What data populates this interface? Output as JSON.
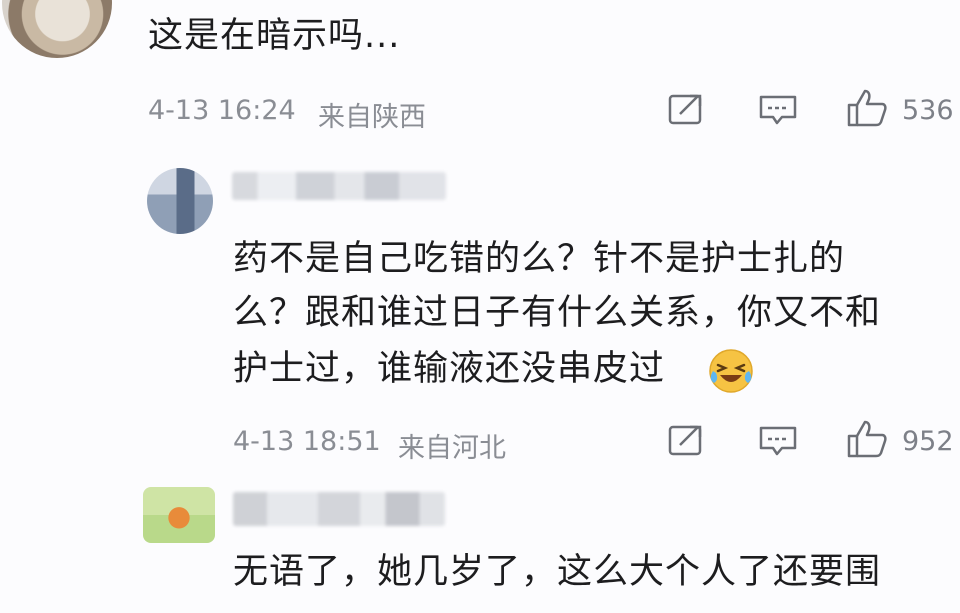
{
  "comments": [
    {
      "text_lines": [
        "这是在暗示吗..."
      ],
      "date": "4-13 16:24",
      "location": "来自陕西",
      "likes": "536",
      "actions": {
        "repost_icon": "repost-icon",
        "reply_icon": "comment-icon",
        "like_icon": "thumbs-up-icon"
      }
    },
    {
      "text_lines": [
        "药不是自己吃错的么？针不是护士扎的",
        "么？跟和谁过日子有什么关系，你又不和",
        "护士过，谁输液还没串皮过"
      ],
      "emoji": "laughing-crying-emoji",
      "date": "4-13 18:51",
      "location": "来自河北",
      "likes": "952",
      "actions": {
        "repost_icon": "repost-icon",
        "reply_icon": "comment-icon",
        "like_icon": "thumbs-up-icon"
      }
    },
    {
      "text_lines": [
        "无语了，她几岁了，这么大个人了还要围"
      ]
    }
  ],
  "colors": {
    "text": "#1d1d1f",
    "meta": "#8a8d94",
    "icon": "#6b6e75",
    "emoji_face": "#f6c343"
  }
}
